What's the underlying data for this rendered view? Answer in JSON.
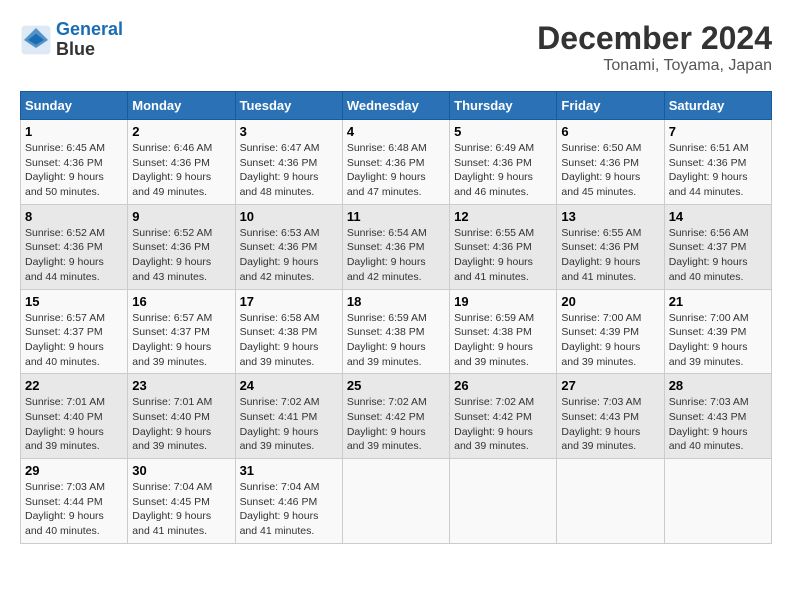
{
  "logo": {
    "line1": "General",
    "line2": "Blue"
  },
  "title": "December 2024",
  "subtitle": "Tonami, Toyama, Japan",
  "days_header": [
    "Sunday",
    "Monday",
    "Tuesday",
    "Wednesday",
    "Thursday",
    "Friday",
    "Saturday"
  ],
  "weeks": [
    [
      {
        "day": "1",
        "info": "Sunrise: 6:45 AM\nSunset: 4:36 PM\nDaylight: 9 hours\nand 50 minutes."
      },
      {
        "day": "2",
        "info": "Sunrise: 6:46 AM\nSunset: 4:36 PM\nDaylight: 9 hours\nand 49 minutes."
      },
      {
        "day": "3",
        "info": "Sunrise: 6:47 AM\nSunset: 4:36 PM\nDaylight: 9 hours\nand 48 minutes."
      },
      {
        "day": "4",
        "info": "Sunrise: 6:48 AM\nSunset: 4:36 PM\nDaylight: 9 hours\nand 47 minutes."
      },
      {
        "day": "5",
        "info": "Sunrise: 6:49 AM\nSunset: 4:36 PM\nDaylight: 9 hours\nand 46 minutes."
      },
      {
        "day": "6",
        "info": "Sunrise: 6:50 AM\nSunset: 4:36 PM\nDaylight: 9 hours\nand 45 minutes."
      },
      {
        "day": "7",
        "info": "Sunrise: 6:51 AM\nSunset: 4:36 PM\nDaylight: 9 hours\nand 44 minutes."
      }
    ],
    [
      {
        "day": "8",
        "info": "Sunrise: 6:52 AM\nSunset: 4:36 PM\nDaylight: 9 hours\nand 44 minutes."
      },
      {
        "day": "9",
        "info": "Sunrise: 6:52 AM\nSunset: 4:36 PM\nDaylight: 9 hours\nand 43 minutes."
      },
      {
        "day": "10",
        "info": "Sunrise: 6:53 AM\nSunset: 4:36 PM\nDaylight: 9 hours\nand 42 minutes."
      },
      {
        "day": "11",
        "info": "Sunrise: 6:54 AM\nSunset: 4:36 PM\nDaylight: 9 hours\nand 42 minutes."
      },
      {
        "day": "12",
        "info": "Sunrise: 6:55 AM\nSunset: 4:36 PM\nDaylight: 9 hours\nand 41 minutes."
      },
      {
        "day": "13",
        "info": "Sunrise: 6:55 AM\nSunset: 4:36 PM\nDaylight: 9 hours\nand 41 minutes."
      },
      {
        "day": "14",
        "info": "Sunrise: 6:56 AM\nSunset: 4:37 PM\nDaylight: 9 hours\nand 40 minutes."
      }
    ],
    [
      {
        "day": "15",
        "info": "Sunrise: 6:57 AM\nSunset: 4:37 PM\nDaylight: 9 hours\nand 40 minutes."
      },
      {
        "day": "16",
        "info": "Sunrise: 6:57 AM\nSunset: 4:37 PM\nDaylight: 9 hours\nand 39 minutes."
      },
      {
        "day": "17",
        "info": "Sunrise: 6:58 AM\nSunset: 4:38 PM\nDaylight: 9 hours\nand 39 minutes."
      },
      {
        "day": "18",
        "info": "Sunrise: 6:59 AM\nSunset: 4:38 PM\nDaylight: 9 hours\nand 39 minutes."
      },
      {
        "day": "19",
        "info": "Sunrise: 6:59 AM\nSunset: 4:38 PM\nDaylight: 9 hours\nand 39 minutes."
      },
      {
        "day": "20",
        "info": "Sunrise: 7:00 AM\nSunset: 4:39 PM\nDaylight: 9 hours\nand 39 minutes."
      },
      {
        "day": "21",
        "info": "Sunrise: 7:00 AM\nSunset: 4:39 PM\nDaylight: 9 hours\nand 39 minutes."
      }
    ],
    [
      {
        "day": "22",
        "info": "Sunrise: 7:01 AM\nSunset: 4:40 PM\nDaylight: 9 hours\nand 39 minutes."
      },
      {
        "day": "23",
        "info": "Sunrise: 7:01 AM\nSunset: 4:40 PM\nDaylight: 9 hours\nand 39 minutes."
      },
      {
        "day": "24",
        "info": "Sunrise: 7:02 AM\nSunset: 4:41 PM\nDaylight: 9 hours\nand 39 minutes."
      },
      {
        "day": "25",
        "info": "Sunrise: 7:02 AM\nSunset: 4:42 PM\nDaylight: 9 hours\nand 39 minutes."
      },
      {
        "day": "26",
        "info": "Sunrise: 7:02 AM\nSunset: 4:42 PM\nDaylight: 9 hours\nand 39 minutes."
      },
      {
        "day": "27",
        "info": "Sunrise: 7:03 AM\nSunset: 4:43 PM\nDaylight: 9 hours\nand 39 minutes."
      },
      {
        "day": "28",
        "info": "Sunrise: 7:03 AM\nSunset: 4:43 PM\nDaylight: 9 hours\nand 40 minutes."
      }
    ],
    [
      {
        "day": "29",
        "info": "Sunrise: 7:03 AM\nSunset: 4:44 PM\nDaylight: 9 hours\nand 40 minutes."
      },
      {
        "day": "30",
        "info": "Sunrise: 7:04 AM\nSunset: 4:45 PM\nDaylight: 9 hours\nand 41 minutes."
      },
      {
        "day": "31",
        "info": "Sunrise: 7:04 AM\nSunset: 4:46 PM\nDaylight: 9 hours\nand 41 minutes."
      },
      null,
      null,
      null,
      null
    ]
  ]
}
